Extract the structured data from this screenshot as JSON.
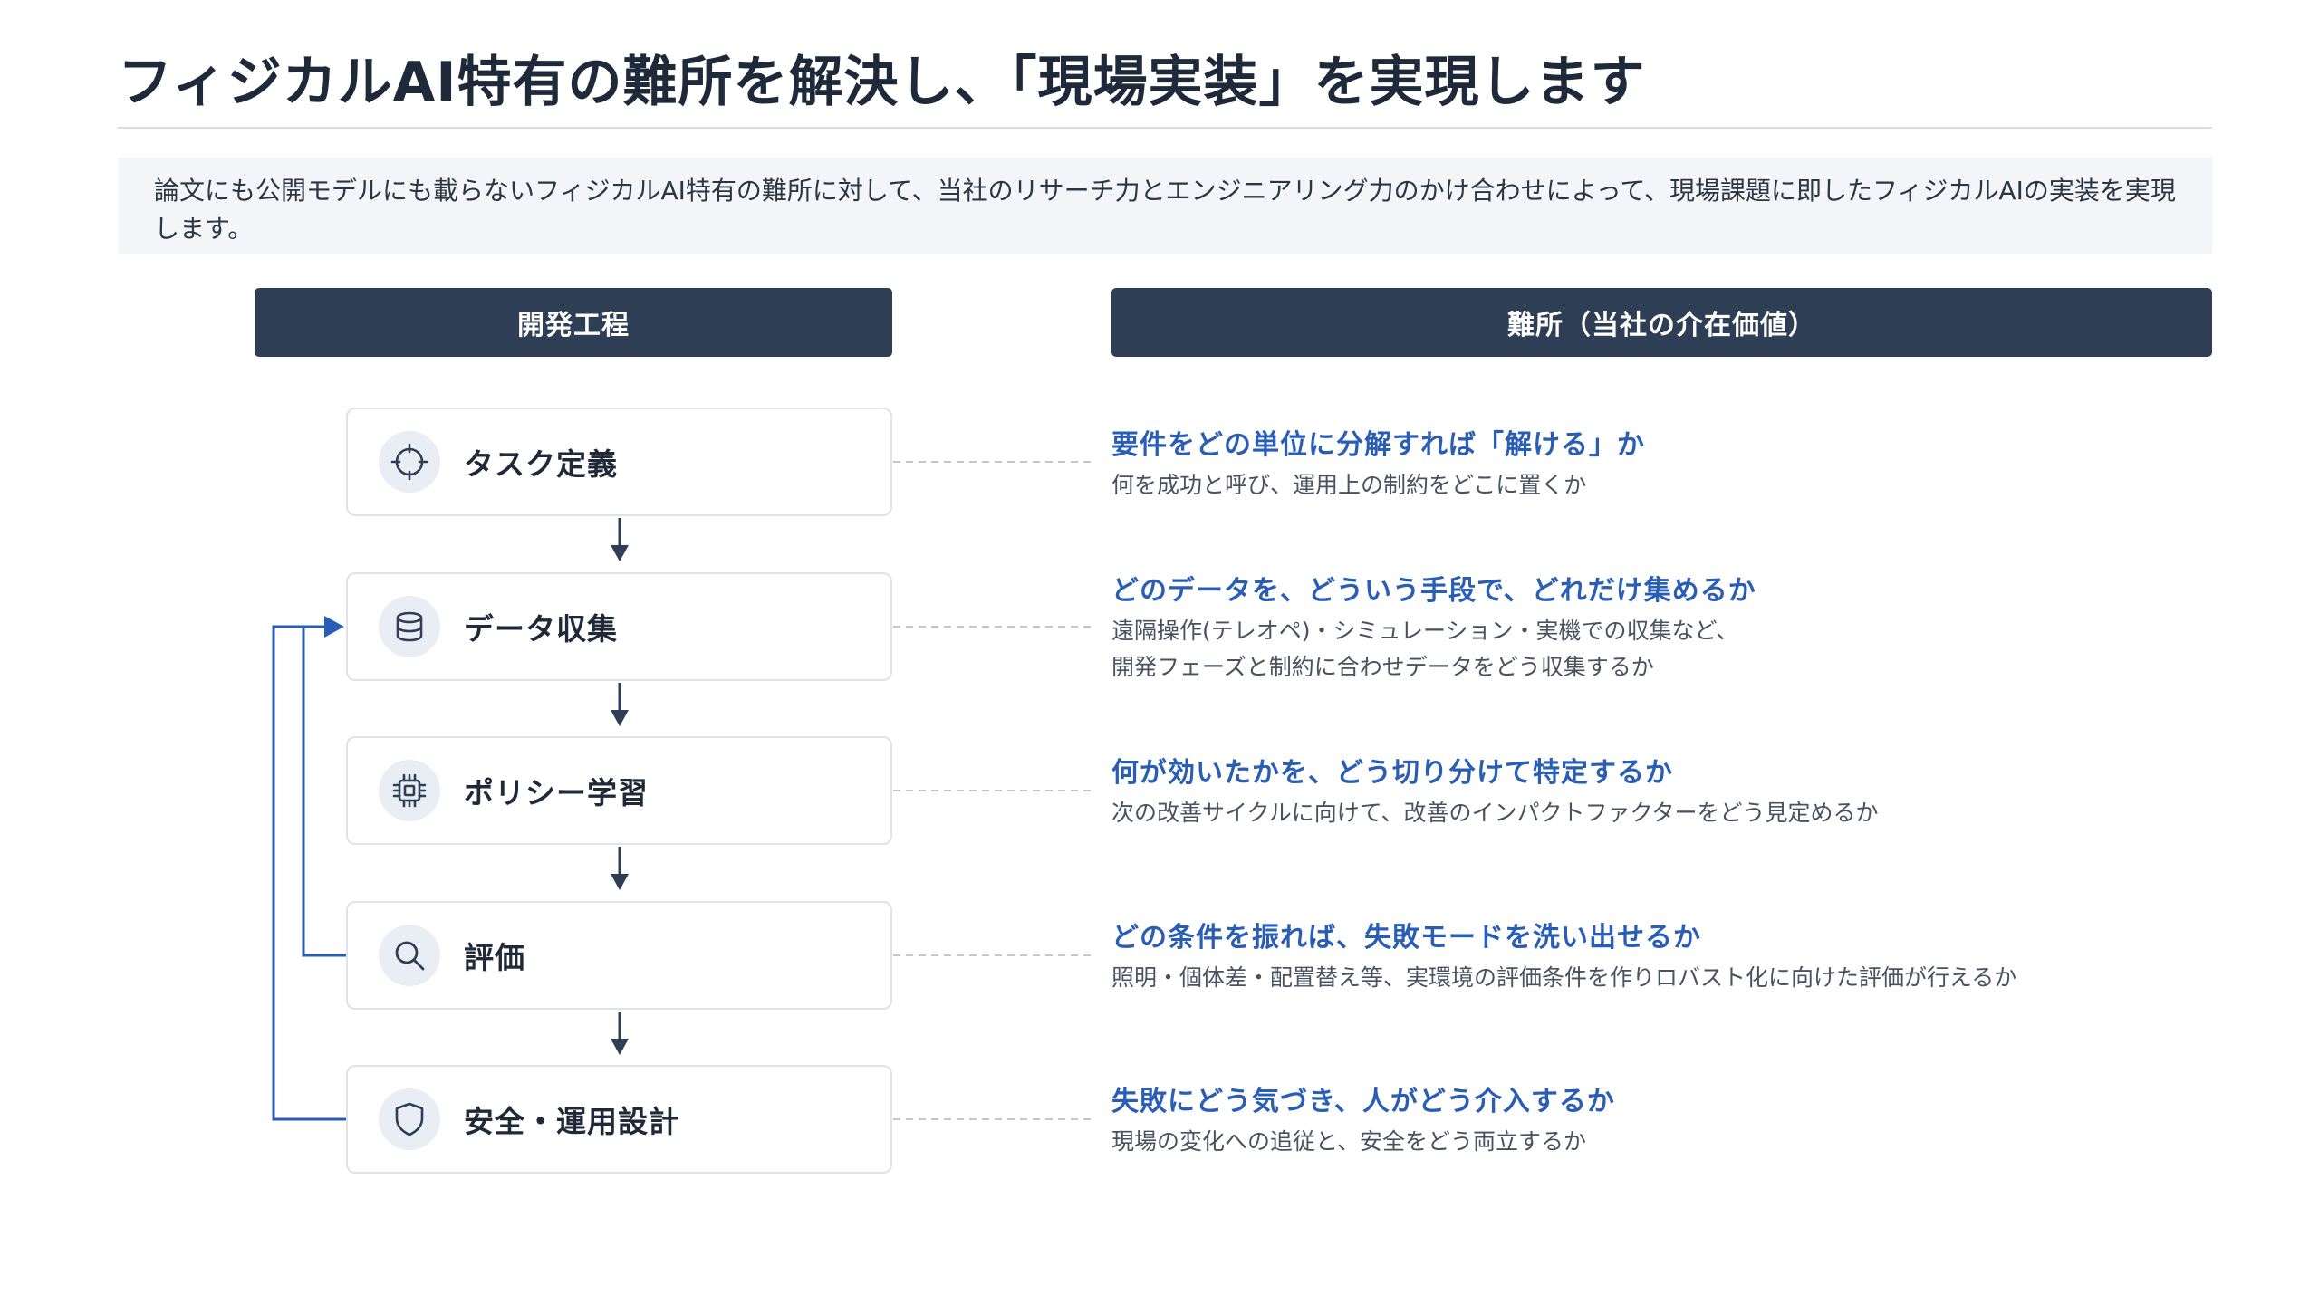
{
  "title": "フィジカルAI特有の難所を解決し、「現場実装」を実現します",
  "lead": "論文にも公開モデルにも載らないフィジカルAI特有の難所に対して、当社のリサーチ力とエンジニアリング力のかけ合わせによって、現場課題に即したフィジカルAIの実装を実現します。",
  "headers": {
    "process": "開発工程",
    "difficulty": "難所（当社の介在価値）"
  },
  "steps": [
    {
      "label": "タスク定義",
      "icon": "crosshair-icon"
    },
    {
      "label": "データ収集",
      "icon": "database-icon"
    },
    {
      "label": "ポリシー学習",
      "icon": "chip-icon"
    },
    {
      "label": "評価",
      "icon": "search-icon"
    },
    {
      "label": "安全・運用設計",
      "icon": "shield-icon"
    }
  ],
  "difficulties": [
    {
      "title": "要件をどの単位に分解すれば「解ける」か",
      "lines": [
        "何を成功と呼び、運用上の制約をどこに置くか"
      ]
    },
    {
      "title": "どのデータを、どういう手段で、どれだけ集めるか",
      "lines": [
        "遠隔操作(テレオペ)・シミュレーション・実機での収集など、",
        "開発フェーズと制約に合わせデータをどう収集するか"
      ]
    },
    {
      "title": "何が効いたかを、どう切り分けて特定するか",
      "lines": [
        "次の改善サイクルに向けて、改善のインパクトファクターをどう見定めるか"
      ]
    },
    {
      "title": "どの条件を振れば、失敗モードを洗い出せるか",
      "lines": [
        "照明・個体差・配置替え等、実環境の評価条件を作りロバスト化に向けた評価が行えるか"
      ]
    },
    {
      "title": "失敗にどう気づき、人がどう介入するか",
      "lines": [
        "現場の変化への追従と、安全をどう両立するか"
      ]
    }
  ],
  "colors": {
    "header_bg": "#2e3e55",
    "accent_blue": "#2a5eb5",
    "flow_arrow": "#2e3e55",
    "feedback_arrow": "#2a5eb5"
  }
}
